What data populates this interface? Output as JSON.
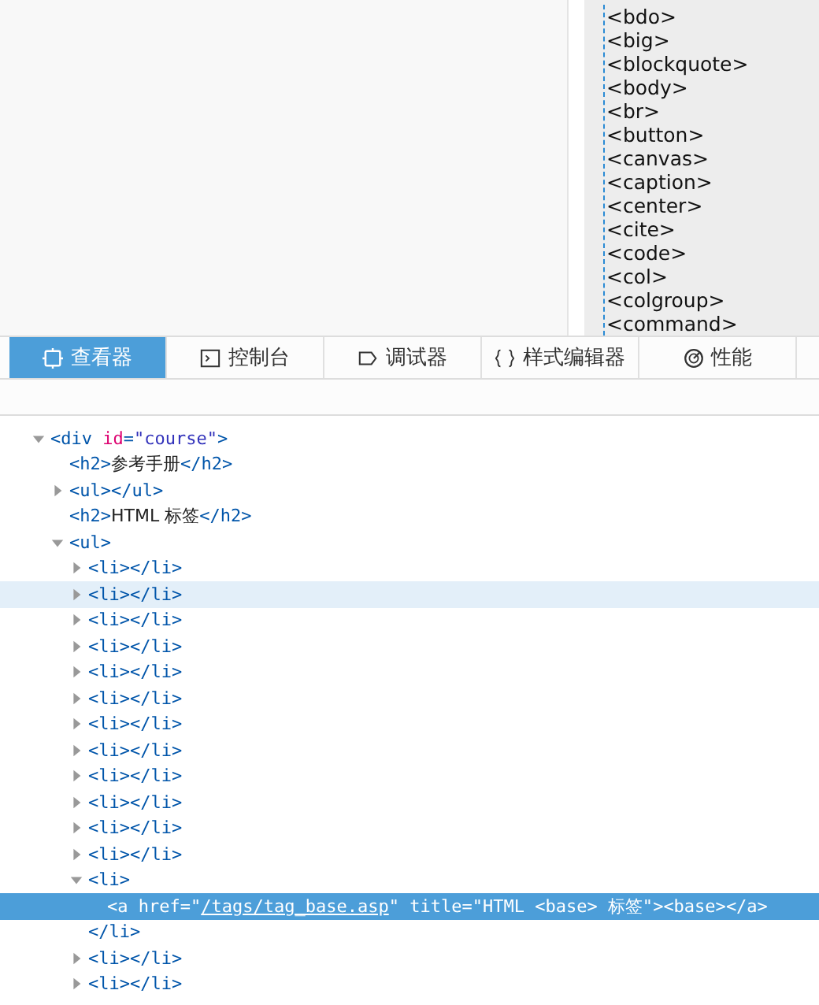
{
  "element_list": [
    "<bdo>",
    "<big>",
    "<blockquote>",
    "<body>",
    "<br>",
    "<button>",
    "<canvas>",
    "<caption>",
    "<center>",
    "<cite>",
    "<code>",
    "<col>",
    "<colgroup>",
    "<command>"
  ],
  "tabs": [
    {
      "label": "查看器",
      "selected": true
    },
    {
      "label": "控制台",
      "selected": false
    },
    {
      "label": "调试器",
      "selected": false
    },
    {
      "label": "样式编辑器",
      "selected": false
    },
    {
      "label": "性能",
      "selected": false
    }
  ],
  "tree": [
    {
      "parts": [
        {
          "kind": "tag",
          "text": "<div"
        },
        {
          "kind": "attr",
          "text": " id"
        },
        {
          "kind": "tag",
          "text": "="
        },
        {
          "kind": "value",
          "text": "\"course\""
        },
        {
          "kind": "tag",
          "text": ">"
        }
      ],
      "expanded": true,
      "children": [
        {
          "parts": [
            {
              "kind": "tag",
              "text": "<h2>"
            },
            {
              "kind": "text",
              "text": "参考手册"
            },
            {
              "kind": "tag",
              "text": "</h2>"
            }
          ]
        },
        {
          "parts": [
            {
              "kind": "tag",
              "text": "<ul></ul>"
            }
          ],
          "expanded": false
        },
        {
          "parts": [
            {
              "kind": "tag",
              "text": "<h2>"
            },
            {
              "kind": "text",
              "text": "HTML 标签"
            },
            {
              "kind": "tag",
              "text": "</h2>"
            }
          ]
        },
        {
          "parts": [
            {
              "kind": "tag",
              "text": "<ul>"
            }
          ],
          "expanded": true,
          "children": [
            {
              "parts": [
                {
                  "kind": "tag",
                  "text": "<li></li>"
                }
              ],
              "expanded": false,
              "hovered": false
            },
            {
              "parts": [
                {
                  "kind": "tag",
                  "text": "<li></li>"
                }
              ],
              "expanded": false,
              "hovered": true
            },
            {
              "parts": [
                {
                  "kind": "tag",
                  "text": "<li></li>"
                }
              ],
              "expanded": false,
              "hovered": false
            },
            {
              "parts": [
                {
                  "kind": "tag",
                  "text": "<li></li>"
                }
              ],
              "expanded": false,
              "hovered": false
            },
            {
              "parts": [
                {
                  "kind": "tag",
                  "text": "<li></li>"
                }
              ],
              "expanded": false,
              "hovered": false
            },
            {
              "parts": [
                {
                  "kind": "tag",
                  "text": "<li></li>"
                }
              ],
              "expanded": false,
              "hovered": false
            },
            {
              "parts": [
                {
                  "kind": "tag",
                  "text": "<li></li>"
                }
              ],
              "expanded": false,
              "hovered": false
            },
            {
              "parts": [
                {
                  "kind": "tag",
                  "text": "<li></li>"
                }
              ],
              "expanded": false,
              "hovered": false
            },
            {
              "parts": [
                {
                  "kind": "tag",
                  "text": "<li></li>"
                }
              ],
              "expanded": false,
              "hovered": false
            },
            {
              "parts": [
                {
                  "kind": "tag",
                  "text": "<li></li>"
                }
              ],
              "expanded": false,
              "hovered": false
            },
            {
              "parts": [
                {
                  "kind": "tag",
                  "text": "<li></li>"
                }
              ],
              "expanded": false,
              "hovered": false
            },
            {
              "parts": [
                {
                  "kind": "tag",
                  "text": "<li></li>"
                }
              ],
              "expanded": false,
              "hovered": false
            },
            {
              "parts": [
                {
                  "kind": "tag",
                  "text": "<li>"
                }
              ],
              "expanded": true,
              "closing": "</li>",
              "children": [
                {
                  "parts": [
                    {
                      "kind": "tag",
                      "text": "<a"
                    },
                    {
                      "kind": "attr",
                      "text": " href"
                    },
                    {
                      "kind": "tag",
                      "text": "="
                    },
                    {
                      "kind": "value",
                      "text": "\""
                    },
                    {
                      "kind": "link",
                      "text": "/tags/tag_base.asp"
                    },
                    {
                      "kind": "value",
                      "text": "\""
                    },
                    {
                      "kind": "attr",
                      "text": " title"
                    },
                    {
                      "kind": "tag",
                      "text": "="
                    },
                    {
                      "kind": "value",
                      "text": "\"HTML <base> 标签\""
                    },
                    {
                      "kind": "tag",
                      "text": ">"
                    },
                    {
                      "kind": "text",
                      "text": "<base>"
                    },
                    {
                      "kind": "tag",
                      "text": "</a>"
                    }
                  ],
                  "selected": true
                }
              ]
            },
            {
              "parts": [
                {
                  "kind": "tag",
                  "text": "<li></li>"
                }
              ],
              "expanded": false,
              "hovered": false
            },
            {
              "parts": [
                {
                  "kind": "tag",
                  "text": "<li></li>"
                }
              ],
              "expanded": false,
              "hovered": false
            }
          ]
        }
      ]
    }
  ]
}
